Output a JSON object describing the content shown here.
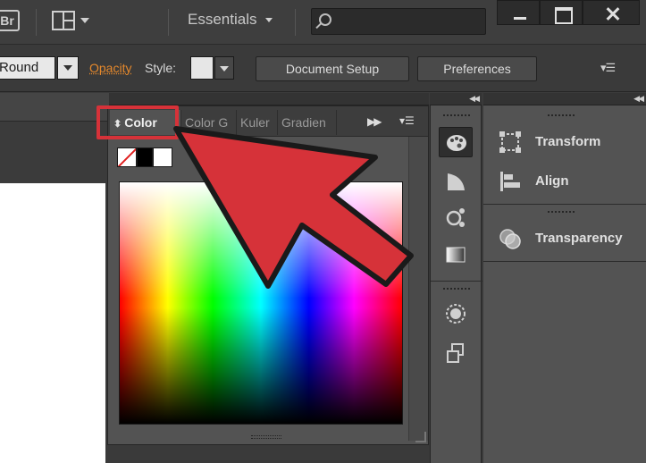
{
  "app": {
    "bridge_badge": "Br",
    "workspace_label": "Essentials"
  },
  "control_bar": {
    "brush_value": "Round",
    "opacity_label": "Opacity",
    "style_label": "Style:",
    "document_setup_label": "Document Setup",
    "preferences_label": "Preferences"
  },
  "color_panel": {
    "tabs": [
      {
        "label": "Color",
        "active": true
      },
      {
        "label": "Color G",
        "active": false
      },
      {
        "label": "Kuler",
        "active": false
      },
      {
        "label": "Gradien",
        "active": false
      }
    ],
    "quick_swatches": [
      "none",
      "#000000",
      "#ffffff"
    ]
  },
  "tool_strip": {
    "tools": [
      "color-palette-icon",
      "gradient-swatch-icon",
      "color-guide-icon",
      "gradient-icon",
      "appearance-icon",
      "stroke-arrange-icon"
    ]
  },
  "right_panel": {
    "items": [
      {
        "label": "Transform",
        "icon": "transform-icon"
      },
      {
        "label": "Align",
        "icon": "align-icon"
      },
      {
        "label": "Transparency",
        "icon": "transparency-icon"
      }
    ]
  },
  "colors": {
    "highlight": "#d63239",
    "pointer_arrow": "#d63239",
    "opacity_link": "#e4882c"
  }
}
